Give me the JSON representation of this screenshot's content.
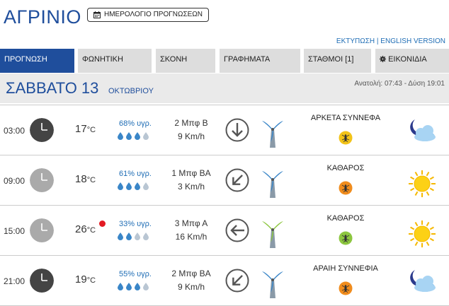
{
  "header": {
    "city": "ΑΓΡΙΝΙΟ",
    "calendar_button": "ΗΜΕΡΟΛΟΓΙΟ ΠΡΟΓΝΩΣΕΩΝ",
    "print_link": "ΕΚΤΥΠΩΣΗ",
    "separator": "|",
    "english_link": "ENGLISH VERSION"
  },
  "tabs": [
    {
      "label": "ΠΡΟΓΝΩΣΗ",
      "active": true
    },
    {
      "label": "ΦΩΝΗΤΙΚΗ",
      "active": false
    },
    {
      "label": "ΣΚΟΝΗ",
      "active": false
    },
    {
      "label": "ΓΡΑΦΗΜΑΤΑ",
      "active": false
    },
    {
      "label": "ΣΤΑΘΜΟΙ [1]",
      "active": false
    },
    {
      "label": "ΕΙΚΟΝΙΔΙΑ",
      "active": false,
      "icon": "gear-icon"
    }
  ],
  "day": {
    "name": "ΣΑΒΒΑΤΟ 13",
    "month": "ΟΚΤΩΒΡΙΟΥ",
    "sun_times": "Ανατολή: 07:43 - Δύση 19:01"
  },
  "colors": {
    "brand_blue": "#1f4e9c",
    "night_clock": "#444444",
    "day_clock": "#aaaaaa",
    "drop_full": "#3a86c8",
    "drop_empty": "#b9c6d3",
    "bug_yellow": "#f2c318",
    "bug_orange": "#f08c1d",
    "bug_green": "#8cc63f",
    "red_dot": "#e31b23"
  },
  "forecast": [
    {
      "time": "03:00",
      "clock": "night-clock-icon",
      "temp": "17",
      "unit": "°C",
      "high_marker": false,
      "humidity": "68% υγρ.",
      "drops_filled": 3,
      "wind_bft": "2 Μπφ Β",
      "wind_kmh": "9 Km/h",
      "wind_dir_icon": "wind-arrow-down-icon",
      "condition": "ΑΡΚΕΤΑ ΣΥΝΝΕΦΑ",
      "bug_color": "yellow",
      "weather_icon": "moon-cloud-icon"
    },
    {
      "time": "09:00",
      "clock": "day-clock-icon",
      "temp": "18",
      "unit": "°C",
      "high_marker": false,
      "humidity": "61% υγρ.",
      "drops_filled": 3,
      "wind_bft": "1 Μπφ ΒΑ",
      "wind_kmh": "3 Km/h",
      "wind_dir_icon": "wind-arrow-southwest-icon",
      "condition": "ΚΑΘΑΡΟΣ",
      "bug_color": "orange",
      "weather_icon": "sun-icon"
    },
    {
      "time": "15:00",
      "clock": "day-clock-icon",
      "temp": "26",
      "unit": "°C",
      "high_marker": true,
      "humidity": "33% υγρ.",
      "drops_filled": 2,
      "wind_bft": "3 Μπφ Α",
      "wind_kmh": "16 Km/h",
      "wind_dir_icon": "wind-arrow-left-icon",
      "condition": "ΚΑΘΑΡΟΣ",
      "bug_color": "green",
      "weather_icon": "sun-icon"
    },
    {
      "time": "21:00",
      "clock": "night-clock-icon",
      "temp": "19",
      "unit": "°C",
      "high_marker": false,
      "humidity": "55% υγρ.",
      "drops_filled": 3,
      "wind_bft": "2 Μπφ ΒΑ",
      "wind_kmh": "9 Km/h",
      "wind_dir_icon": "wind-arrow-southwest-icon",
      "condition": "ΑΡΑΙΗ ΣΥΝΝΕΦΙΑ",
      "bug_color": "orange",
      "weather_icon": "moon-cloud-icon"
    }
  ]
}
